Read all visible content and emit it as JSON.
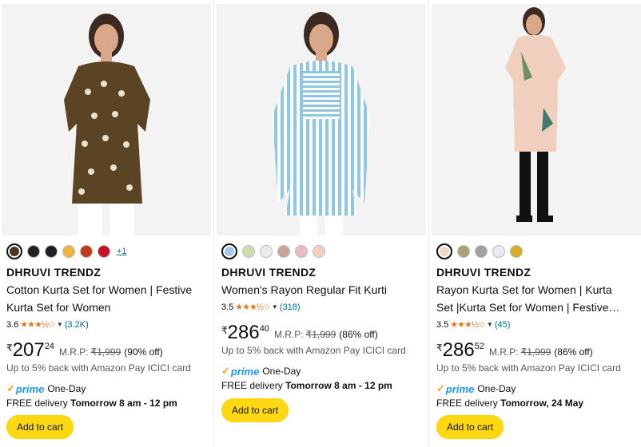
{
  "products": [
    {
      "brand": "DHRUVI TRENDZ",
      "title_line1": "Cotton Kurta Set for Women | Festive",
      "title_line2": "Kurta Set for Women",
      "rating": "3.6",
      "rating_value": 3.6,
      "stars": "★★★½☆",
      "ratings_count": "(3.2K)",
      "currency": "₹",
      "price_whole": "207",
      "price_fraction": "24",
      "mrp_label": "M.R.P:",
      "mrp": "₹1,999",
      "discount": "(90% off)",
      "cashback": "Up to 5% back with Amazon Pay ICICI card",
      "prime_label": "prime",
      "prime_speed": "One-Day",
      "delivery_prefix": "FREE delivery",
      "delivery_date": "Tomorrow 8 am - 12 pm",
      "cta": "Add to cart",
      "more_colors": "+1",
      "swatch_colors": [
        "#4a3620",
        "#222222",
        "#1f1f1f",
        "#f2b33d",
        "#c0391b",
        "#c8102e"
      ],
      "selected_swatch": 0
    },
    {
      "brand": "DHRUVI TRENDZ",
      "title_line1": "Women's Rayon Regular Fit Kurti",
      "title_line2": "",
      "rating": "3.5",
      "rating_value": 3.5,
      "stars": "★★★½☆",
      "ratings_count": "(318)",
      "currency": "₹",
      "price_whole": "286",
      "price_fraction": "40",
      "mrp_label": "M.R.P:",
      "mrp": "₹1,999",
      "discount": "(86% off)",
      "cashback": "Up to 5% back with Amazon Pay ICICI card",
      "prime_label": "prime",
      "prime_speed": "One-Day",
      "delivery_prefix": "FREE delivery",
      "delivery_date": "Tomorrow 8 am - 12 pm",
      "cta": "Add to cart",
      "more_colors": "",
      "swatch_colors": [
        "#a9c8e6",
        "#cfdcb0",
        "#eeeaea",
        "#c9a29a",
        "#e8bcc6",
        "#f3cfc0"
      ],
      "selected_swatch": 0
    },
    {
      "brand": "DHRUVI TRENDZ",
      "title_line1": "Rayon Kurta Set for Women | Kurta",
      "title_line2": "Set |Kurta Set for Women | Festive…",
      "rating": "3.5",
      "rating_value": 3.5,
      "stars": "★★★½☆",
      "ratings_count": "(45)",
      "currency": "₹",
      "price_whole": "286",
      "price_fraction": "52",
      "mrp_label": "M.R.P:",
      "mrp": "₹1,999",
      "discount": "(86% off)",
      "cashback": "Up to 5% back with Amazon Pay ICICI card",
      "prime_label": "prime",
      "prime_speed": "One-Day",
      "delivery_prefix": "FREE delivery",
      "delivery_date": "Tomorrow, 24 May",
      "cta": "Add to cart",
      "more_colors": "",
      "swatch_colors": [
        "#f0d6c6",
        "#a9a27a",
        "#a3a0a0",
        "#ebeaf2",
        "#d4ad2a"
      ],
      "selected_swatch": 0
    }
  ]
}
